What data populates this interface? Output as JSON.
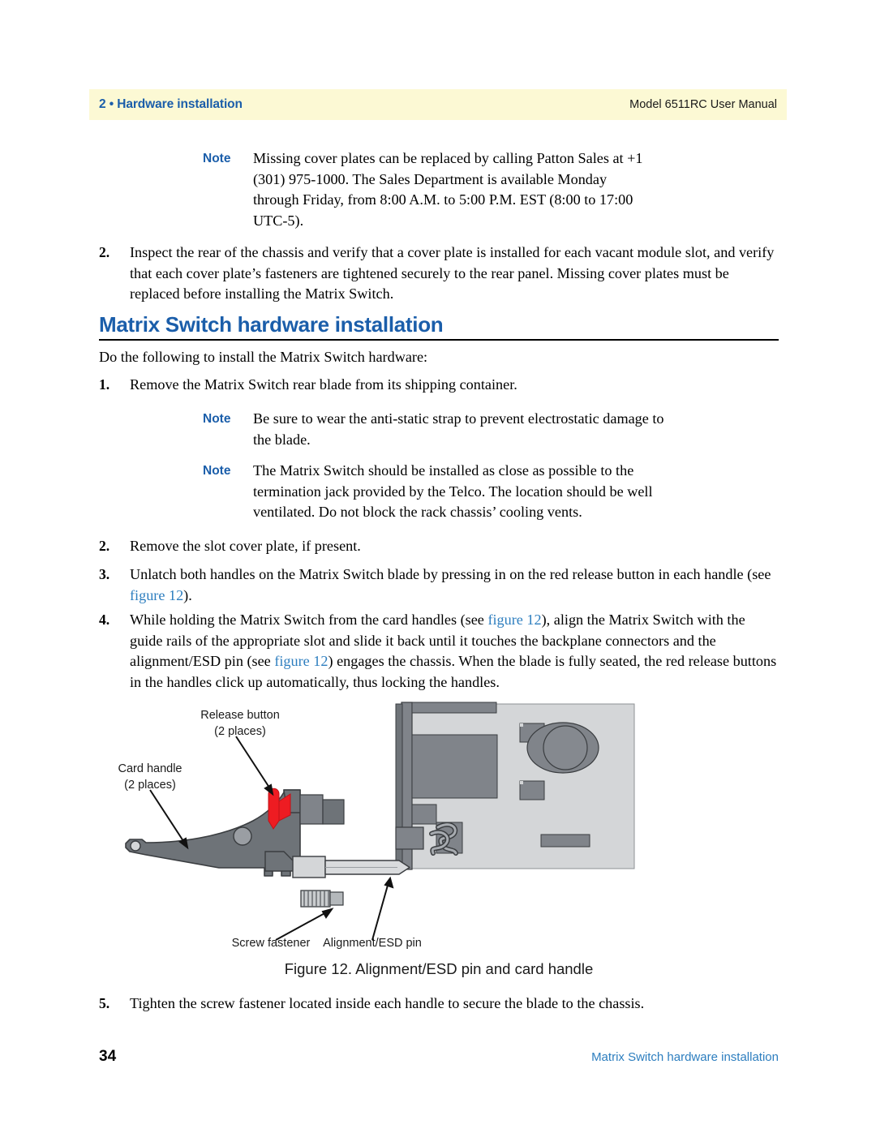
{
  "header": {
    "left": "2 • Hardware installation",
    "right": "Model 6511RC User Manual"
  },
  "note_top": {
    "label": "Note",
    "body": "Missing cover plates can be replaced by calling Patton Sales at +1 (301) 975-1000. The Sales Department is available Monday through Friday, from 8:00 A.M. to 5:00 P.M. EST (8:00 to 17:00 UTC-5)."
  },
  "item_prev_2": {
    "num": "2.",
    "body": "Inspect the rear of the chassis and verify that a cover plate is installed for each vacant module slot, and verify that each cover plate’s fasteners are tightened securely to the rear panel. Missing cover plates must be replaced before installing the Matrix Switch."
  },
  "section": {
    "heading": "Matrix Switch hardware installation",
    "intro": "Do the following to install the Matrix Switch hardware:"
  },
  "steps": {
    "s1": {
      "num": "1.",
      "body": "Remove the Matrix Switch rear blade from its shipping container."
    },
    "s2": {
      "num": "2.",
      "body": "Remove the slot cover plate, if present."
    },
    "s3": {
      "num": "3.",
      "part_a": "Unlatch both handles on the Matrix Switch blade by pressing in on the red release button in each handle (see ",
      "xref": "figure 12",
      "part_b": ")."
    },
    "s4": {
      "num": "4.",
      "part_a": "While holding the Matrix Switch from the card handles (see ",
      "xref_1": "figure 12",
      "part_b": "), align the Matrix Switch with the guide rails of the appropriate slot and slide it back until it touches the backplane connectors and the alignment/ESD pin (see ",
      "xref_2": "figure 12",
      "part_c": ") engages the chassis. When the blade is fully seated, the red release buttons in the handles click up automatically, thus locking the handles."
    },
    "s5": {
      "num": "5.",
      "body": "Tighten the screw fastener located inside each handle to secure the blade to the chassis."
    }
  },
  "notes_mid": [
    {
      "label": "Note",
      "body": "Be sure to wear the anti-static strap to prevent electrostatic damage to the blade."
    },
    {
      "label": "Note",
      "body": "The Matrix Switch should be installed as close as possible to the termination jack provided by the Telco. The location should be well ventilated. Do not block the rack chassis’ cooling vents."
    }
  ],
  "figure": {
    "caption": "Figure 12. Alignment/ESD pin and card handle",
    "labels": {
      "release_button_l1": "Release button",
      "release_button_l2": "(2 places)",
      "card_handle_l1": "Card handle",
      "card_handle_l2": "(2 places)",
      "screw_fastener": "Screw fastener",
      "alignment_pin": "Alignment/ESD pin"
    },
    "colors": {
      "panel": "#d4d6d8",
      "component": "#80848a",
      "handle": "#6e7378",
      "release_button": "#ee1c22",
      "pin": "#d4d6d8",
      "outline": "#3a3d40"
    }
  },
  "footer": {
    "page_number": "34",
    "title": "Matrix Switch hardware installation"
  }
}
